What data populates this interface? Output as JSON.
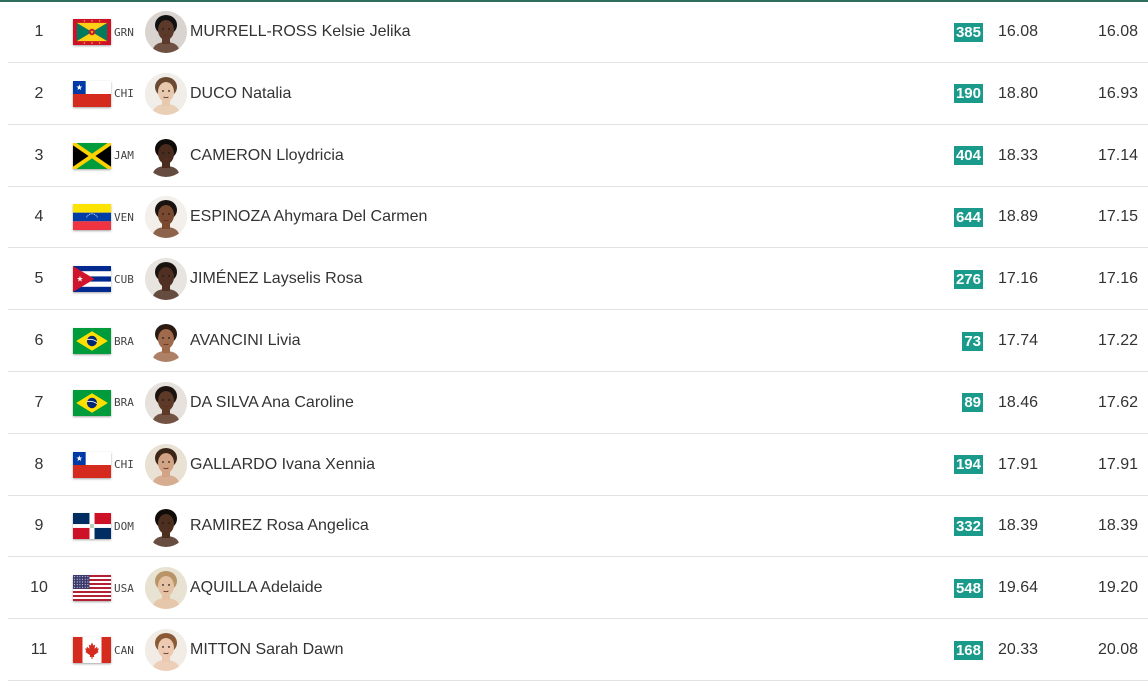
{
  "results": [
    {
      "rank": "1",
      "noc": "GRN",
      "name": "MURRELL-ROSS Kelsie Jelika",
      "bib": "385",
      "time1": "16.08",
      "time2": "16.08",
      "skin": "#5b3a2a",
      "hair": "#111111",
      "bg": "#d9d4d0"
    },
    {
      "rank": "2",
      "noc": "CHI",
      "name": "DUCO Natalia",
      "bib": "190",
      "time1": "18.80",
      "time2": "16.93",
      "skin": "#e9c9ae",
      "hair": "#6b4a32",
      "bg": "#f1ede9"
    },
    {
      "rank": "3",
      "noc": "JAM",
      "name": "CAMERON Lloydricia",
      "bib": "404",
      "time1": "18.33",
      "time2": "17.14",
      "skin": "#4a2c1e",
      "hair": "#0e0b0a",
      "bg": "#ffffff"
    },
    {
      "rank": "4",
      "noc": "VEN",
      "name": "ESPINOZA Ahymara Del Carmen",
      "bib": "644",
      "time1": "18.89",
      "time2": "17.15",
      "skin": "#7a4a30",
      "hair": "#1a1210",
      "bg": "#f3efeb"
    },
    {
      "rank": "5",
      "noc": "CUB",
      "name": "JIMÉNEZ Layselis Rosa",
      "bib": "276",
      "time1": "17.16",
      "time2": "17.16",
      "skin": "#4f3022",
      "hair": "#1a1310",
      "bg": "#e8e4e0"
    },
    {
      "rank": "6",
      "noc": "BRA",
      "name": "AVANCINI Livia",
      "bib": "73",
      "time1": "17.74",
      "time2": "17.22",
      "skin": "#a06b4c",
      "hair": "#2a1a12",
      "bg": "#ffffff"
    },
    {
      "rank": "7",
      "noc": "BRA",
      "name": "DA SILVA Ana Caroline",
      "bib": "89",
      "time1": "18.46",
      "time2": "17.62",
      "skin": "#5d3a28",
      "hair": "#1d130e",
      "bg": "#e6e1dd"
    },
    {
      "rank": "8",
      "noc": "CHI",
      "name": "GALLARDO Ivana Xennia",
      "bib": "194",
      "time1": "17.91",
      "time2": "17.91",
      "skin": "#d2a384",
      "hair": "#3b2618",
      "bg": "#e9e2d4"
    },
    {
      "rank": "9",
      "noc": "DOM",
      "name": "RAMIREZ Rosa Angelica",
      "bib": "332",
      "time1": "18.39",
      "time2": "18.39",
      "skin": "#4d2f20",
      "hair": "#120c09",
      "bg": "#ffffff"
    },
    {
      "rank": "10",
      "noc": "USA",
      "name": "AQUILLA Adelaide",
      "bib": "548",
      "time1": "19.64",
      "time2": "19.20",
      "skin": "#e6c2a4",
      "hair": "#b89466",
      "bg": "#e8e2d2"
    },
    {
      "rank": "11",
      "noc": "CAN",
      "name": "MITTON Sarah Dawn",
      "bib": "168",
      "time1": "20.33",
      "time2": "20.08",
      "skin": "#ecc9b0",
      "hair": "#8a5a36",
      "bg": "#f2ece6"
    }
  ],
  "colors": {
    "bib_bg": "#1a9a8a",
    "top_border": "#2f6f5e",
    "row_divider": "#e2e2e2"
  },
  "icons": {
    "GRN": "flag-grenada-icon",
    "CHI": "flag-chile-icon",
    "JAM": "flag-jamaica-icon",
    "VEN": "flag-venezuela-icon",
    "CUB": "flag-cuba-icon",
    "BRA": "flag-brazil-icon",
    "DOM": "flag-dominican-republic-icon",
    "USA": "flag-usa-icon",
    "CAN": "flag-canada-icon"
  }
}
